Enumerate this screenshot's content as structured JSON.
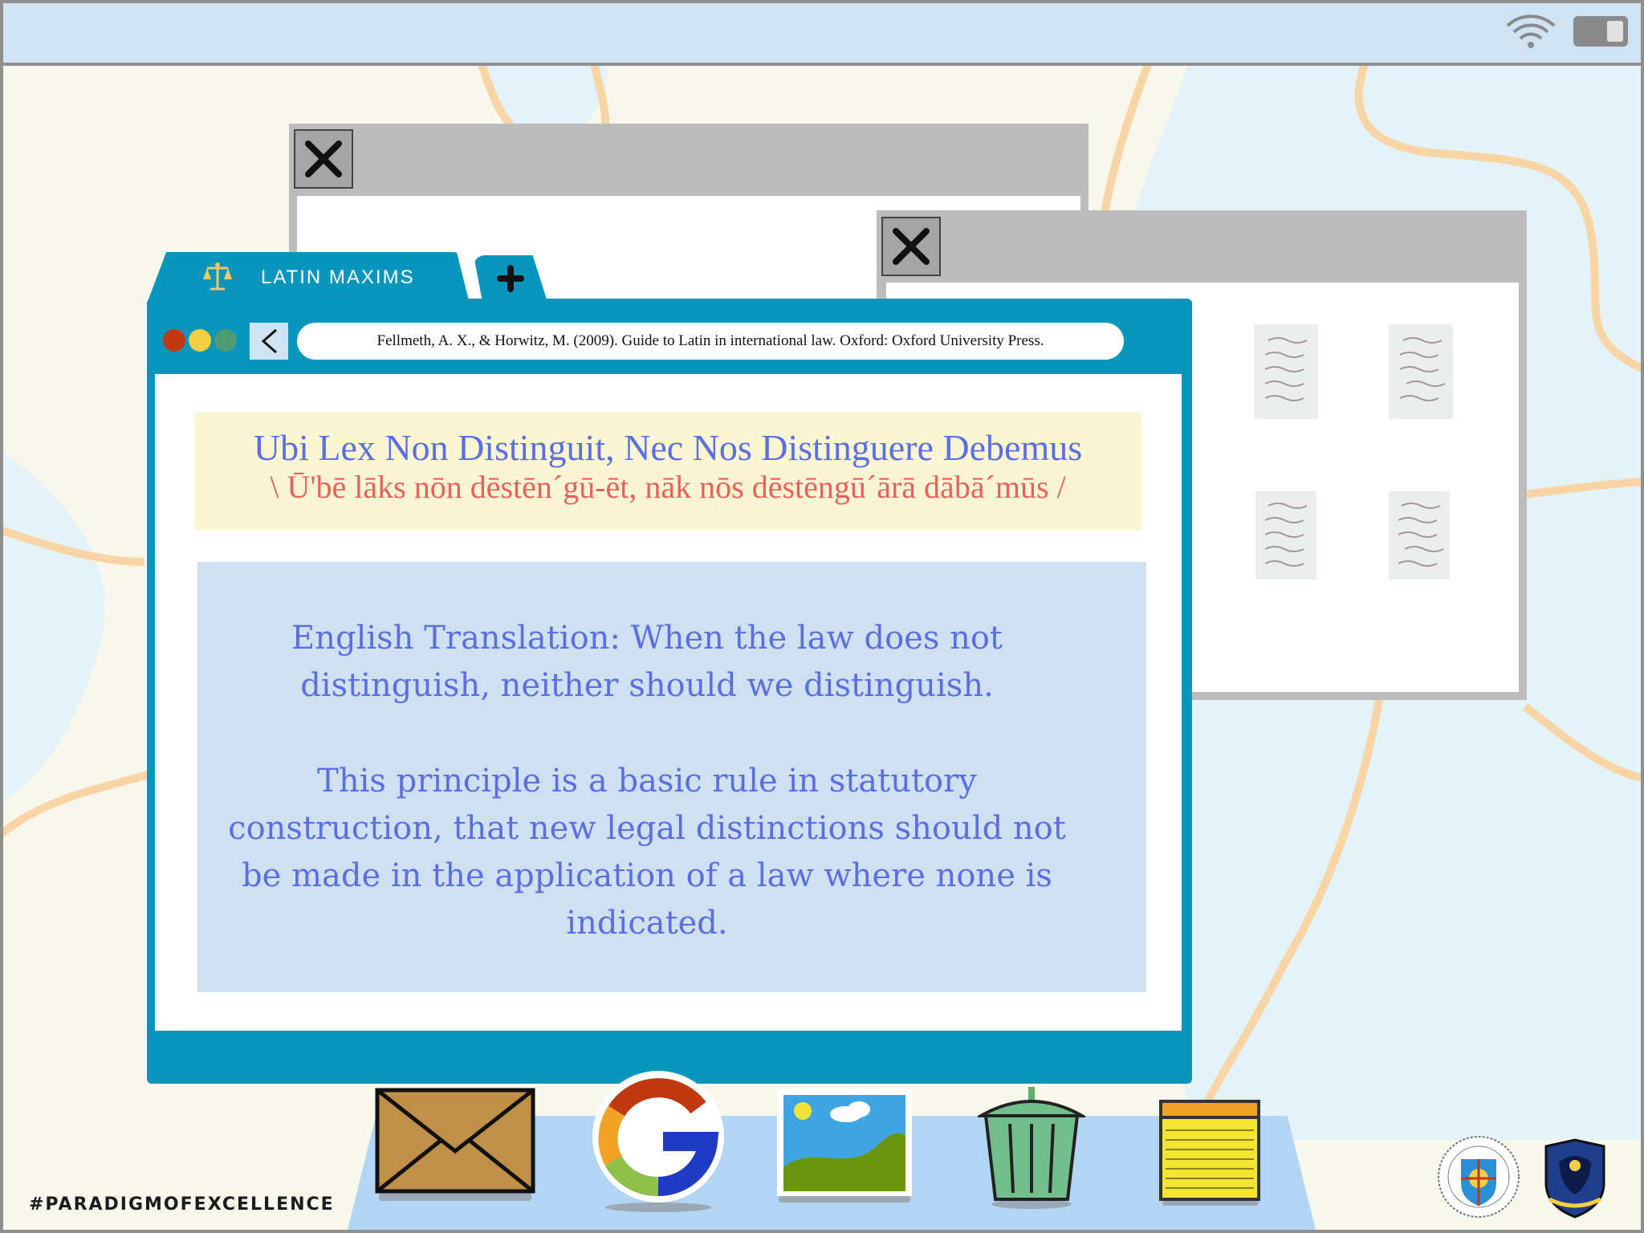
{
  "browser": {
    "tab_label": "LATIN MAXIMS",
    "address_text": "Fellmeth, A. X., & Horwitz, M. (2009). Guide to Latin in international law. Oxford: Oxford University Press."
  },
  "maxim": {
    "title": "Ubi Lex Non Distinguit, Nec Nos Distinguere Debemus",
    "pronunciation": "\\ Ū'bē lāks nōn dēstēn´gū-ēt, nāk nōs dēstēngū´ārā dābā´mūs /"
  },
  "description": {
    "translation": "English Translation: When the law does not distinguish, neither should we distinguish.",
    "explanation": "This principle is a basic rule in statutory construction, that new legal distinctions should not be made in the application of a law where none is indicated."
  },
  "footer": {
    "hashtag": "#PARADIGMOFEXCELLENCE"
  },
  "icons": {
    "status": [
      "wifi-icon",
      "battery-icon"
    ],
    "dock": [
      "mail-icon",
      "google-icon",
      "photos-icon",
      "trash-icon",
      "notes-icon"
    ]
  },
  "colors": {
    "browser_accent": "#0896bd",
    "title_text": "#5b6fe0",
    "pronunciation_text": "#e8615c",
    "title_background": "#faf5d3",
    "description_background": "#cfe0f0",
    "topbar": "#cfe3f2",
    "dock": "#b1d5f3"
  }
}
